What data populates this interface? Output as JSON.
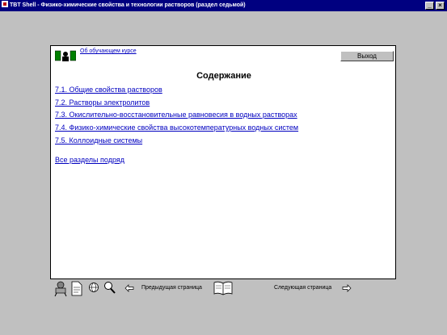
{
  "window": {
    "title": "TBT Shell - Физико-химические свойства и технологии растворов (раздел седьмой)",
    "minimize": "_",
    "close": "×"
  },
  "header": {
    "about_link": "Об обучающем курсе",
    "exit_label": "Выход"
  },
  "main": {
    "heading": "Содержание",
    "toc": [
      "7.1. Общие свойства растворов",
      "7.2. Растворы электролитов",
      "7.3. Окислительно-восстановительные равновесия в водных растворах",
      "7.4. Физико-химические свойства высокотемпературных водных систем",
      "7.5. Коллоидные системы"
    ],
    "all_sections": "Все разделы подряд"
  },
  "bottom": {
    "prev_label": "Предыдущая страница",
    "next_label": "Следующая страница"
  },
  "icons": [
    "course-manager-icon",
    "notes-icon",
    "globe-icon",
    "search-icon",
    "prev-arrow-icon",
    "book-icon",
    "next-arrow-icon"
  ]
}
